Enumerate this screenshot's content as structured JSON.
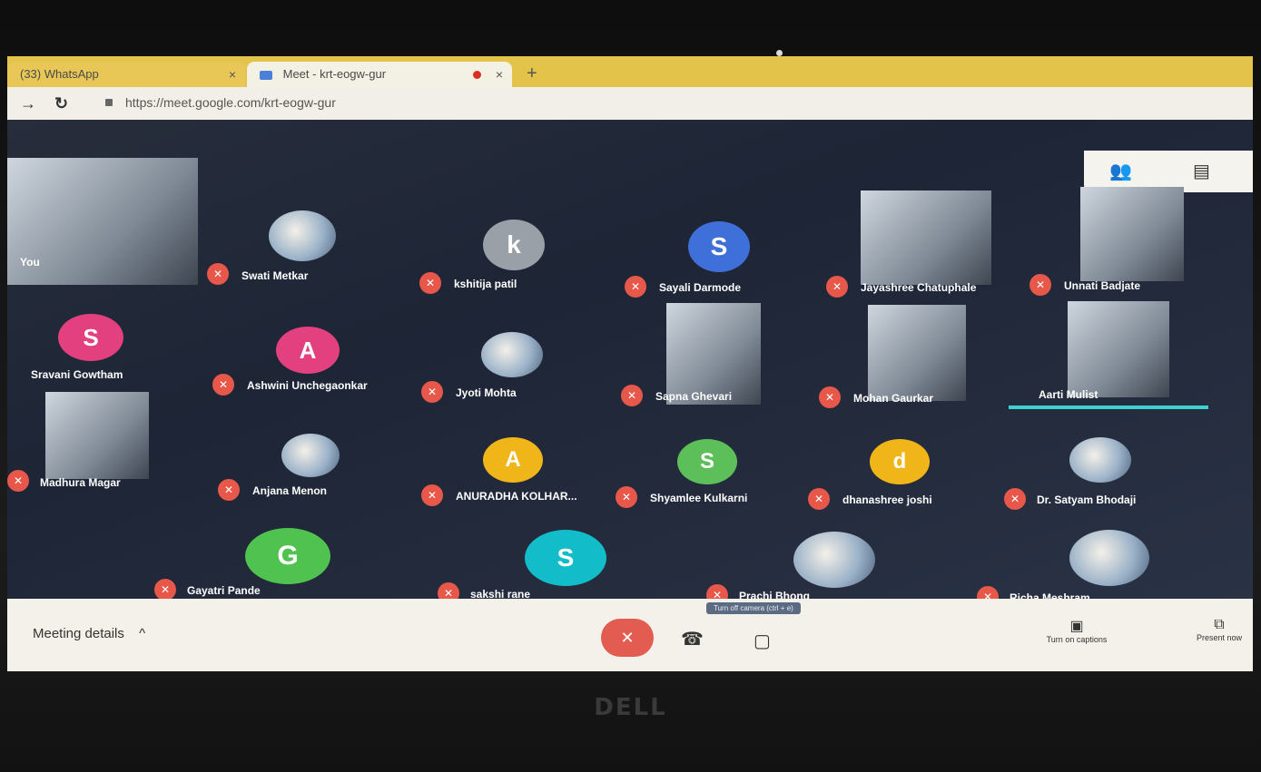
{
  "browser": {
    "tabs": [
      {
        "label": "(33) WhatsApp",
        "close": "×"
      },
      {
        "label": "Meet - krt-eogw-gur",
        "close": "×"
      }
    ],
    "new_tab": "+",
    "url": "https://meet.google.com/krt-eogw-gur"
  },
  "meet": {
    "participants": [
      {
        "name": "You",
        "type": "video"
      },
      {
        "name": "Swati Metkar",
        "type": "photo"
      },
      {
        "name": "kshitija patil",
        "type": "initial",
        "initial": "k",
        "color": "#9aa0a8"
      },
      {
        "name": "Sayali Darmode",
        "type": "initial",
        "initial": "S",
        "color": "#3f6fd8"
      },
      {
        "name": "Jayashree Chatuphale",
        "type": "video"
      },
      {
        "name": "Unnati Badjate",
        "type": "video"
      },
      {
        "name": "Sravani Gowtham",
        "type": "initial",
        "initial": "S",
        "color": "#e2407e"
      },
      {
        "name": "Ashwini Unchegaonkar",
        "type": "initial",
        "initial": "A",
        "color": "#e2407e"
      },
      {
        "name": "Jyoti Mohta",
        "type": "photo"
      },
      {
        "name": "Sapna Ghevari",
        "type": "video"
      },
      {
        "name": "Mohan Gaurkar",
        "type": "video"
      },
      {
        "name": "Aarti Mulist",
        "type": "video"
      },
      {
        "name": "Madhura Magar",
        "type": "video"
      },
      {
        "name": "Anjana Menon",
        "type": "photo"
      },
      {
        "name": "ANURADHA KOLHAR...",
        "type": "initial",
        "initial": "A",
        "color": "#f0b619"
      },
      {
        "name": "Shyamlee Kulkarni",
        "type": "initial",
        "initial": "S",
        "color": "#5cbf5a"
      },
      {
        "name": "dhanashree joshi",
        "type": "initial",
        "initial": "d",
        "color": "#f0b619"
      },
      {
        "name": "Dr. Satyam Bhodaji",
        "type": "photo"
      },
      {
        "name": "Gayatri Pande",
        "type": "initial",
        "initial": "G",
        "color": "#4fc24f"
      },
      {
        "name": "sakshi rane",
        "type": "initial",
        "initial": "S",
        "color": "#12bcc8"
      },
      {
        "name": "Prachi Bhong",
        "type": "photo"
      },
      {
        "name": "Richa Meshram",
        "type": "photo"
      }
    ],
    "tooltip": "Turn off camera (ctrl + e)",
    "meeting_details": "Meeting details",
    "captions_label": "Turn on captions",
    "present_label": "Present now",
    "brand": "DELL"
  },
  "colors": {
    "mic_off": "#e8584a",
    "tabbar": "#e3c34a",
    "end_call": "#e35c52"
  }
}
